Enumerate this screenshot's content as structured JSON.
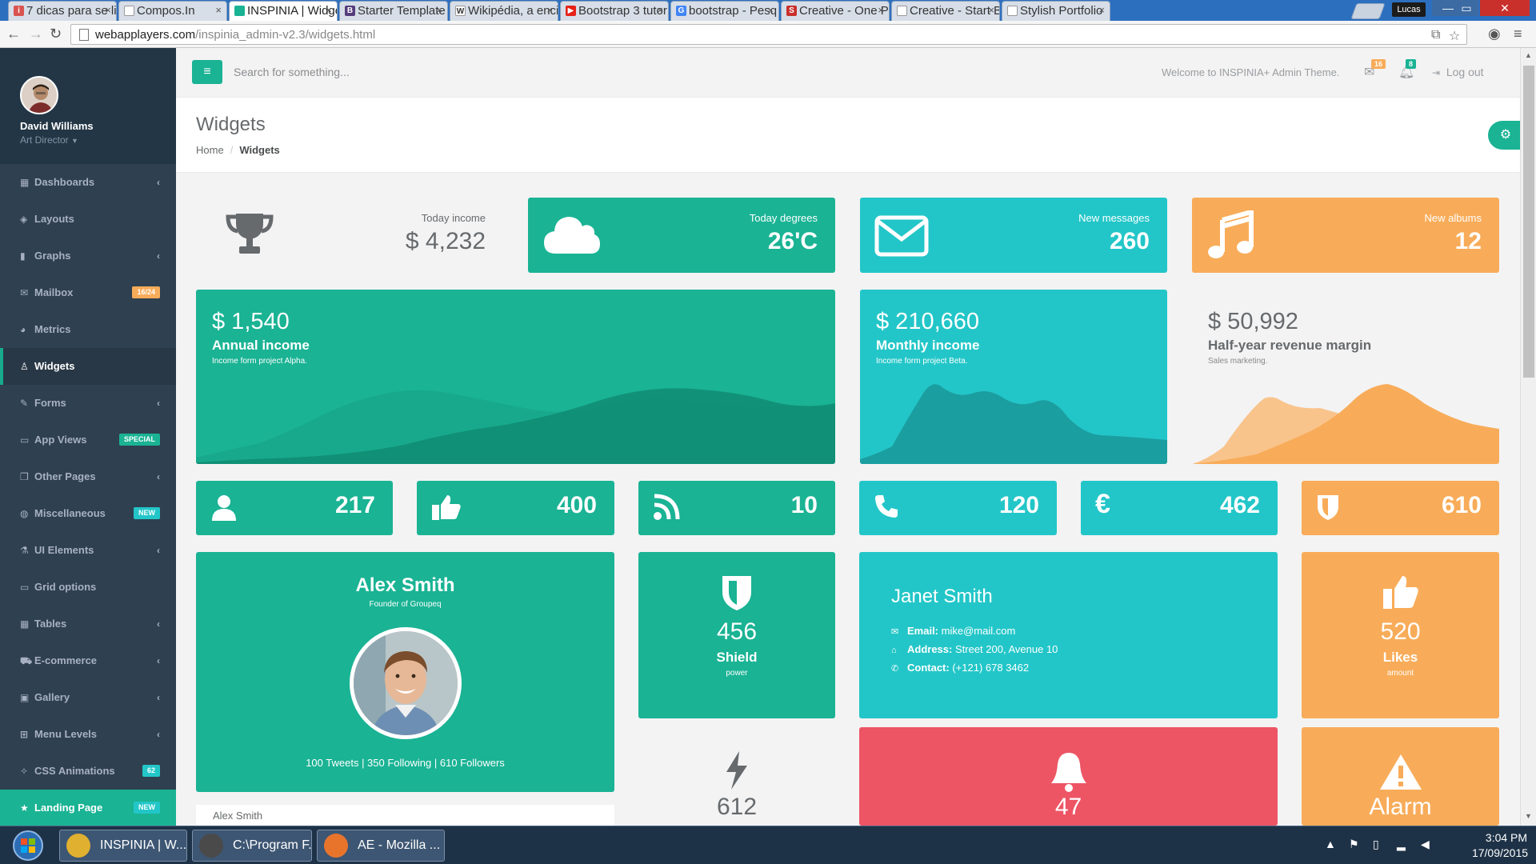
{
  "browser": {
    "tabs": [
      {
        "title": "7 dicas para se li",
        "fav_color": "#d9534f",
        "fav_glyph": "i"
      },
      {
        "title": "Compos.In",
        "fav_color": "#ffffff",
        "fav_glyph": ""
      },
      {
        "title": "INSPINIA | Widge",
        "fav_color": "#1ab394",
        "fav_glyph": ""
      },
      {
        "title": "Starter Template",
        "fav_color": "#563d7c",
        "fav_glyph": "B"
      },
      {
        "title": "Wikipédia, a enci",
        "fav_color": "#ffffff",
        "fav_glyph": "W"
      },
      {
        "title": "Bootstrap 3 tutor",
        "fav_color": "#e62117",
        "fav_glyph": "▶"
      },
      {
        "title": "bootstrap - Pesq",
        "fav_color": "#4285f4",
        "fav_glyph": "G"
      },
      {
        "title": "Creative - One P",
        "fav_color": "#c9302c",
        "fav_glyph": "S"
      },
      {
        "title": "Creative - Start B",
        "fav_color": "#ffffff",
        "fav_glyph": ""
      },
      {
        "title": "Stylish Portfolio",
        "fav_color": "#ffffff",
        "fav_glyph": ""
      }
    ],
    "user_tag": "Lucas",
    "url_host": "webapplayers.com",
    "url_path": "/inspinia_admin-v2.3/widgets.html"
  },
  "sidebar": {
    "user_name": "David Williams",
    "user_role": "Art Director",
    "items": [
      {
        "label": "Dashboards",
        "icon": "th-large-icon",
        "glyph": "▦",
        "arrow": true,
        "badge": "",
        "badge_class": ""
      },
      {
        "label": "Layouts",
        "icon": "diamond-icon",
        "glyph": "◈",
        "arrow": false,
        "badge": "",
        "badge_class": ""
      },
      {
        "label": "Graphs",
        "icon": "bar-chart-icon",
        "glyph": "▮",
        "arrow": true,
        "badge": "",
        "badge_class": ""
      },
      {
        "label": "Mailbox",
        "icon": "envelope-icon",
        "glyph": "✉",
        "arrow": false,
        "badge": "16/24",
        "badge_class": "badge-warning"
      },
      {
        "label": "Metrics",
        "icon": "pie-chart-icon",
        "glyph": "◕",
        "arrow": false,
        "badge": "",
        "badge_class": ""
      },
      {
        "label": "Widgets",
        "icon": "flask-icon",
        "glyph": "♙",
        "arrow": false,
        "badge": "",
        "badge_class": "",
        "active": true
      },
      {
        "label": "Forms",
        "icon": "edit-icon",
        "glyph": "✎",
        "arrow": true,
        "badge": "",
        "badge_class": ""
      },
      {
        "label": "App Views",
        "icon": "desktop-icon",
        "glyph": "▭",
        "arrow": false,
        "badge": "SPECIAL",
        "badge_class": "badge-primary"
      },
      {
        "label": "Other Pages",
        "icon": "files-icon",
        "glyph": "❐",
        "arrow": true,
        "badge": "",
        "badge_class": ""
      },
      {
        "label": "Miscellaneous",
        "icon": "globe-icon",
        "glyph": "◍",
        "arrow": false,
        "badge": "NEW",
        "badge_class": "badge-info"
      },
      {
        "label": "UI Elements",
        "icon": "flask-icon",
        "glyph": "⚗",
        "arrow": true,
        "badge": "",
        "badge_class": ""
      },
      {
        "label": "Grid options",
        "icon": "laptop-icon",
        "glyph": "▭",
        "arrow": false,
        "badge": "",
        "badge_class": ""
      },
      {
        "label": "Tables",
        "icon": "table-icon",
        "glyph": "▦",
        "arrow": true,
        "badge": "",
        "badge_class": ""
      },
      {
        "label": "E-commerce",
        "icon": "cart-icon",
        "glyph": "⛟",
        "arrow": true,
        "badge": "",
        "badge_class": ""
      },
      {
        "label": "Gallery",
        "icon": "picture-icon",
        "glyph": "▣",
        "arrow": true,
        "badge": "",
        "badge_class": ""
      },
      {
        "label": "Menu Levels",
        "icon": "sitemap-icon",
        "glyph": "⊞",
        "arrow": true,
        "badge": "",
        "badge_class": ""
      },
      {
        "label": "CSS Animations",
        "icon": "magic-icon",
        "glyph": "✧",
        "arrow": false,
        "badge": "62",
        "badge_class": "badge-info"
      },
      {
        "label": "Landing Page",
        "icon": "star-icon",
        "glyph": "★",
        "arrow": false,
        "badge": "NEW",
        "badge_class": "badge-info",
        "landing": true
      }
    ]
  },
  "topbar": {
    "search_placeholder": "Search for something...",
    "welcome": "Welcome to INSPINIA+ Admin Theme.",
    "mail_count": "16",
    "bell_count": "8",
    "logout": "Log out"
  },
  "heading": {
    "title": "Widgets",
    "crumb_home": "Home",
    "crumb_current": "Widgets"
  },
  "row1": {
    "income_label": "Today income",
    "income_value": "$ 4,232",
    "degrees_label": "Today degrees",
    "degrees_value": "26'C",
    "messages_label": "New messages",
    "messages_value": "260",
    "albums_label": "New albums",
    "albums_value": "12"
  },
  "row2": {
    "annual_amount": "$ 1,540",
    "annual_title": "Annual income",
    "annual_sub": "Income form project Alpha.",
    "monthly_amount": "$ 210,660",
    "monthly_title": "Monthly income",
    "monthly_sub": "Income form project Beta.",
    "half_amount": "$ 50,992",
    "half_title": "Half-year revenue margin",
    "half_sub": "Sales marketing."
  },
  "row3": {
    "users": "217",
    "likes": "400",
    "rss": "10",
    "phone": "120",
    "euro": "462",
    "shield": "610"
  },
  "profile": {
    "name": "Alex Smith",
    "subtitle": "Founder of Groupeq",
    "stats": "100 Tweets | 350 Following | 610 Followers",
    "footer_name": "Alex Smith"
  },
  "tiles": {
    "shield_num": "456",
    "shield_label": "Shield",
    "shield_sub": "power",
    "bolt_num": "612",
    "likes_num": "520",
    "likes_label": "Likes",
    "likes_sub": "amount",
    "bell_num": "47",
    "alarm_label": "Alarm"
  },
  "contact": {
    "name": "Janet Smith",
    "email_label": "Email:",
    "email": "mike@mail.com",
    "address_label": "Address:",
    "address": "Street 200, Avenue 10",
    "contact_label": "Contact:",
    "phone": "(+121) 678 3462"
  },
  "taskbar": {
    "items": [
      {
        "label": "INSPINIA | W...",
        "color": "#e0b030"
      },
      {
        "label": "C:\\Program F...",
        "color": "#4a4a4a"
      },
      {
        "label": "AE - Mozilla ...",
        "color": "#e8742c"
      }
    ],
    "time": "3:04 PM",
    "date": "17/09/2015"
  },
  "colors": {
    "navy": "#1ab394",
    "lazur": "#23c6c8",
    "yellow": "#f8ac59",
    "red": "#ed5565",
    "sidebar": "#2f4050"
  }
}
